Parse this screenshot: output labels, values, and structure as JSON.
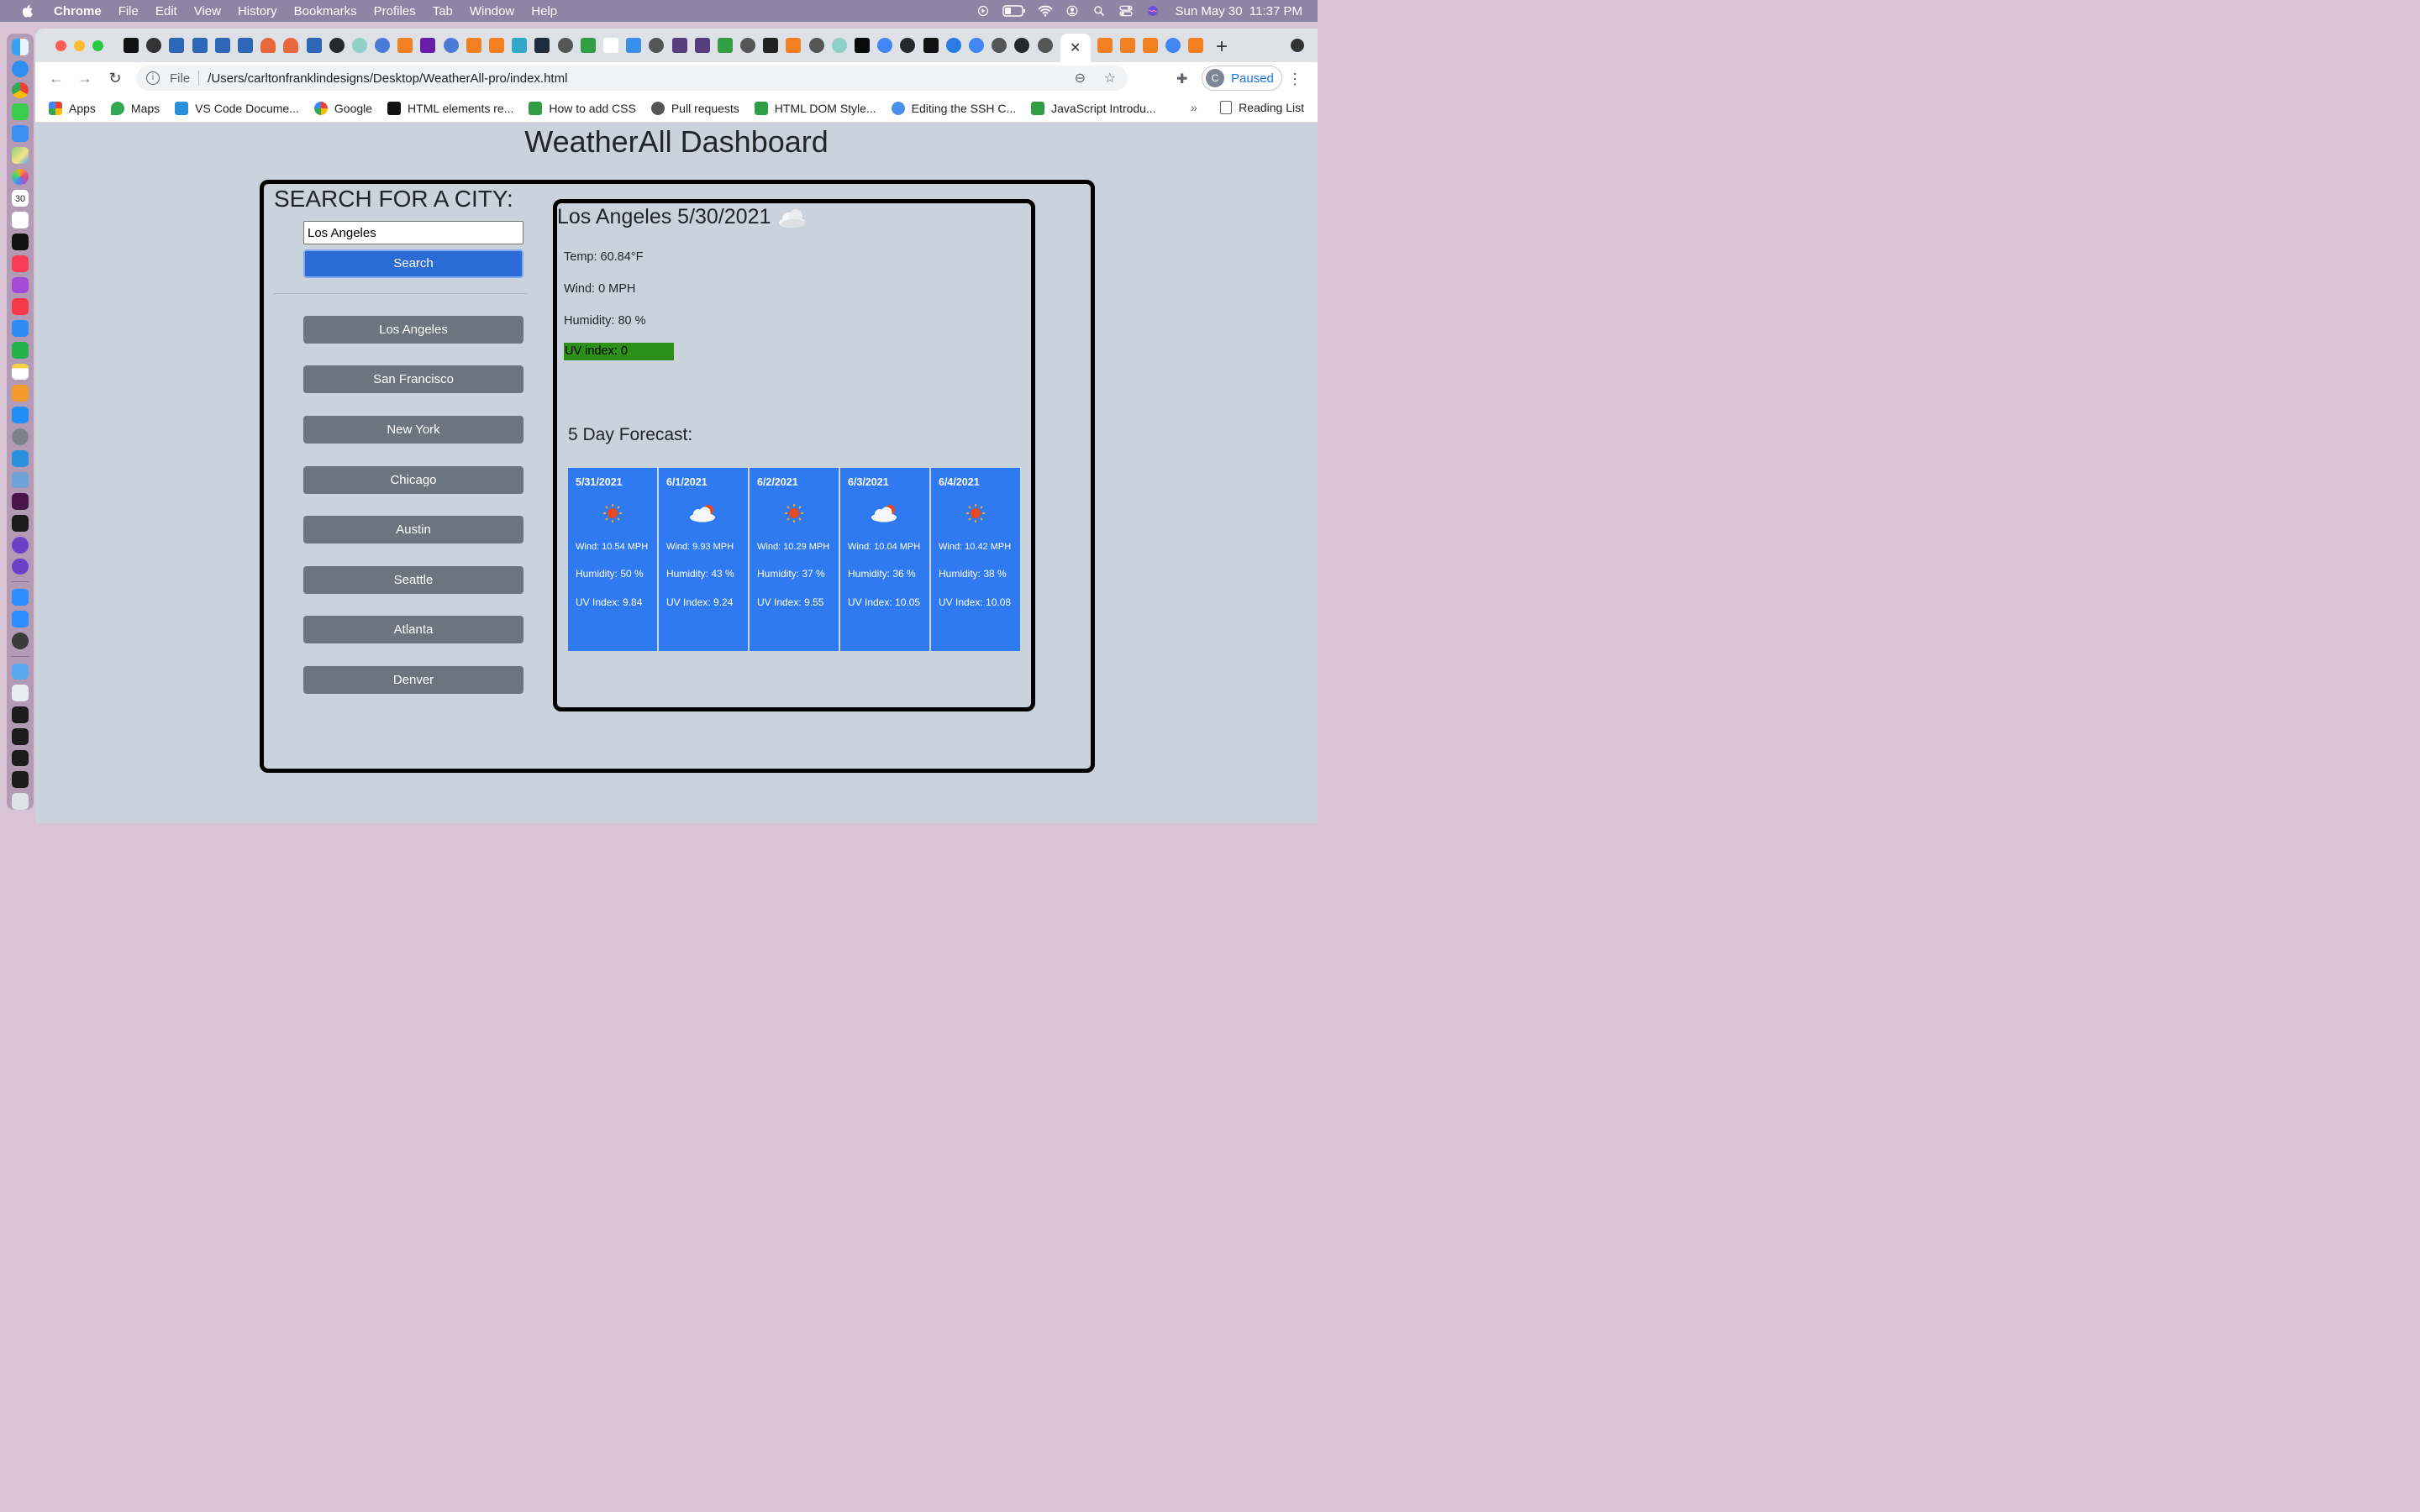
{
  "menubar": {
    "app": "Chrome",
    "items": [
      "File",
      "Edit",
      "View",
      "History",
      "Bookmarks",
      "Profiles",
      "Tab",
      "Window",
      "Help"
    ],
    "clock": "Sun May 30  11:37 PM"
  },
  "browser": {
    "url_scheme": "File",
    "url_path": "/Users/carltonfranklindesigns/Desktop/WeatherAll-pro/index.html",
    "profile_initial": "C",
    "profile_status": "Paused",
    "bookmarks": [
      "Apps",
      "Maps",
      "VS Code Docume...",
      "Google",
      "HTML elements re...",
      "How to add CSS",
      "Pull requests",
      "HTML DOM Style...",
      "Editing the SSH C...",
      "JavaScript Introdu..."
    ],
    "more_bookmarks": "»",
    "reading_list": "Reading List"
  },
  "page": {
    "title": "WeatherAll Dashboard",
    "search_heading": "SEARCH FOR A CITY:",
    "search_value": "Los Angeles",
    "search_button": "Search",
    "history": [
      "Los Angeles",
      "San Francisco",
      "New York",
      "Chicago",
      "Austin",
      "Seattle",
      "Atlanta",
      "Denver"
    ]
  },
  "current": {
    "title": "Los Angeles 5/30/2021",
    "icon": "cloud-icon",
    "temp": "Temp: 60.84°F",
    "wind": "Wind: 0 MPH",
    "humidity": "Humidity: 80 %",
    "uv": "UV index: 0",
    "uv_color": "#2c8f17"
  },
  "forecast": {
    "heading": "5 Day Forecast:",
    "days": [
      {
        "date": "5/31/2021",
        "icon": "sun-icon",
        "wind": "Wind: 10.54 MPH",
        "humidity": "Humidity: 50 %",
        "uv": "UV Index: 9.84"
      },
      {
        "date": "6/1/2021",
        "icon": "sun-cloud-icon",
        "wind": "Wind: 9.93 MPH",
        "humidity": "Humidity: 43 %",
        "uv": "UV Index: 9.24"
      },
      {
        "date": "6/2/2021",
        "icon": "sun-icon",
        "wind": "Wind: 10.29 MPH",
        "humidity": "Humidity: 37 %",
        "uv": "UV Index: 9.55"
      },
      {
        "date": "6/3/2021",
        "icon": "sun-cloud-icon",
        "wind": "Wind: 10.04 MPH",
        "humidity": "Humidity: 36 %",
        "uv": "UV Index: 10.05"
      },
      {
        "date": "6/4/2021",
        "icon": "sun-icon",
        "wind": "Wind: 10.42 MPH",
        "humidity": "Humidity: 38 %",
        "uv": "UV Index: 10.08"
      }
    ],
    "card_color": "#2f7af0"
  }
}
